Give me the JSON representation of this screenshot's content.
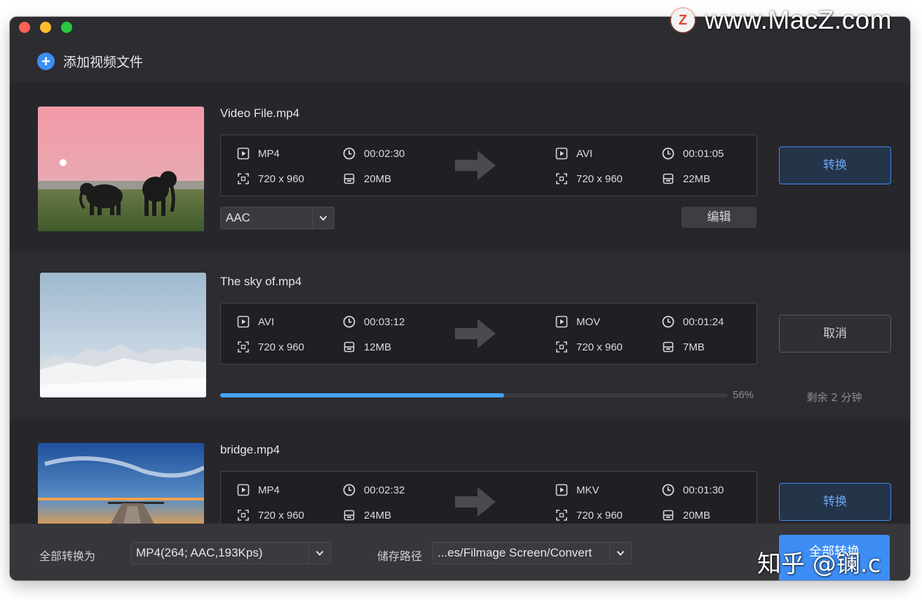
{
  "header": {
    "add_label": "添加视频文件"
  },
  "files": [
    {
      "name": "Video File.mp4",
      "src": {
        "format": "MP4",
        "duration": "00:02:30",
        "resolution": "720 x 960",
        "size": "20MB"
      },
      "dst": {
        "format": "AVI",
        "duration": "00:01:05",
        "resolution": "720 x 960",
        "size": "22MB"
      },
      "audio": "AAC",
      "edit_label": "编辑",
      "action_label": "转换"
    },
    {
      "name": "The sky of.mp4",
      "src": {
        "format": "AVI",
        "duration": "00:03:12",
        "resolution": "720 x 960",
        "size": "12MB"
      },
      "dst": {
        "format": "MOV",
        "duration": "00:01:24",
        "resolution": "720 x 960",
        "size": "7MB"
      },
      "progress_text": "56%",
      "progress_fraction": 0.56,
      "remaining": "剩余 2 分钟",
      "action_label": "取消"
    },
    {
      "name": "bridge.mp4",
      "src": {
        "format": "MP4",
        "duration": "00:02:32",
        "resolution": "720 x 960",
        "size": "24MB"
      },
      "dst": {
        "format": "MKV",
        "duration": "00:01:30",
        "resolution": "720 x 960",
        "size": "20MB"
      },
      "action_label": "转换"
    }
  ],
  "footer": {
    "convert_all_to_label": "全部转换为",
    "convert_all_to_value": "MP4(264; AAC,193Kps)",
    "save_path_label": "储存路径",
    "save_path_value": "...es/Filmage Screen/Convert",
    "convert_all_button": "全部转换"
  },
  "watermarks": {
    "top": "www.MacZ.com",
    "top_logo": "Z",
    "bottom": "知乎 @镧.c"
  },
  "colors": {
    "accent": "#3d8df5",
    "progress": "#43a3f6",
    "window_bg": "#26262b",
    "alt_row_bg": "#2c2c31"
  },
  "icons": {
    "format": "play-square-icon",
    "duration": "clock-icon",
    "resolution": "resize-frame-icon",
    "size": "storage-icon",
    "convert_direction": "arrow-right-icon"
  }
}
